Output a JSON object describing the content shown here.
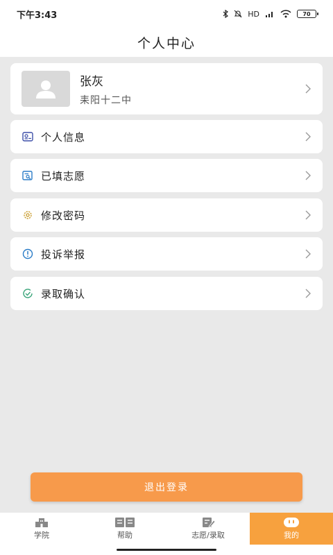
{
  "status": {
    "time": "下午3:43",
    "network": "HD",
    "battery": "70"
  },
  "header": {
    "title": "个人中心"
  },
  "profile": {
    "name": "张灰",
    "school": "耒阳十二中"
  },
  "menu": [
    {
      "label": "个人信息",
      "icon": "id-card-icon",
      "color": "#3d4fa8"
    },
    {
      "label": "已填志愿",
      "icon": "form-search-icon",
      "color": "#2a7cc7"
    },
    {
      "label": "修改密码",
      "icon": "gear-icon",
      "color": "#c89b2a"
    },
    {
      "label": "投诉举报",
      "icon": "info-icon",
      "color": "#2a7cc7"
    },
    {
      "label": "录取确认",
      "icon": "check-circle-icon",
      "color": "#3aa57a"
    }
  ],
  "logout_label": "退出登录",
  "tabs": [
    {
      "label": "学院",
      "icon": "building-icon"
    },
    {
      "label": "帮助",
      "icon": "book-icon"
    },
    {
      "label": "志愿/录取",
      "icon": "edit-icon"
    },
    {
      "label": "我的",
      "icon": "face-icon",
      "active": true
    }
  ],
  "colors": {
    "accent": "#f79a4b",
    "active_tab": "#f7a13e",
    "background": "#e9e9e9"
  }
}
